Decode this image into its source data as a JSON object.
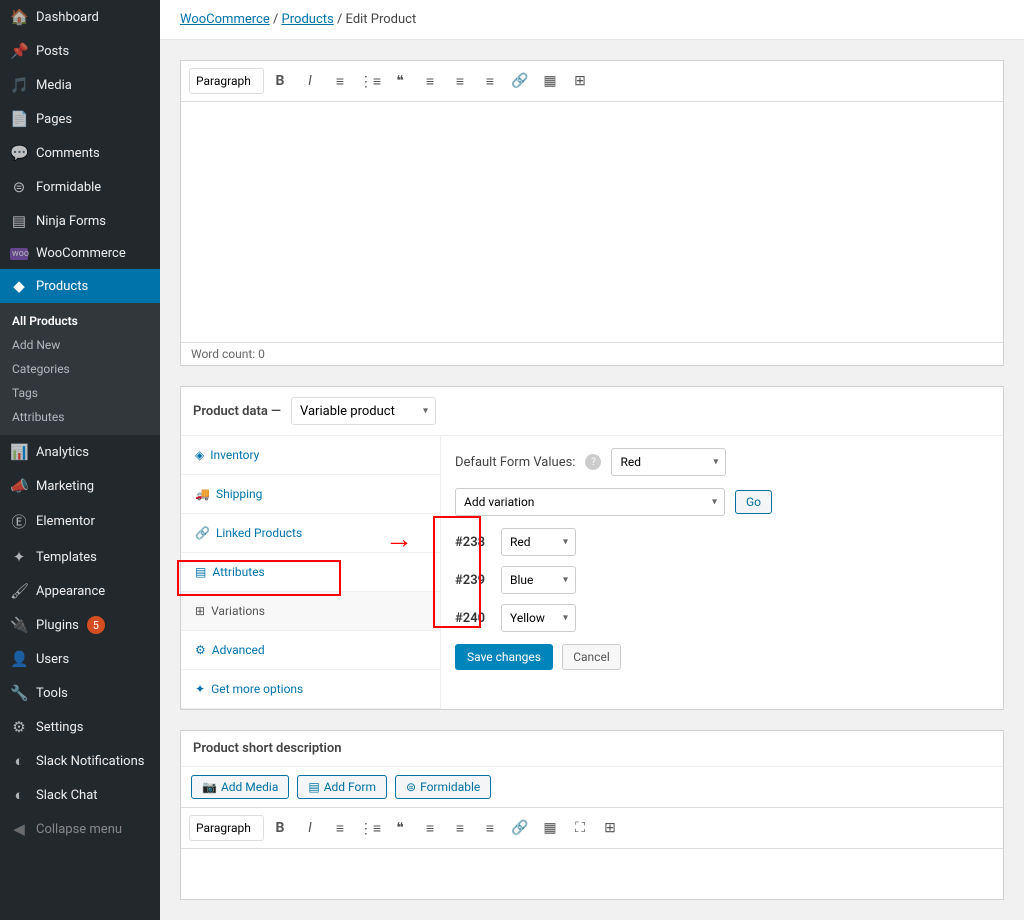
{
  "sidebar": {
    "items": [
      {
        "label": "Dashboard",
        "icon": "⚙"
      },
      {
        "label": "Posts",
        "icon": "📌"
      },
      {
        "label": "Media",
        "icon": "🖼"
      },
      {
        "label": "Pages",
        "icon": "📄"
      },
      {
        "label": "Comments",
        "icon": "💬"
      },
      {
        "label": "Formidable",
        "icon": "⊜"
      },
      {
        "label": "Ninja Forms",
        "icon": "▤"
      },
      {
        "label": "WooCommerce",
        "icon": "woo"
      },
      {
        "label": "Products",
        "icon": "◆"
      },
      {
        "label": "Analytics",
        "icon": "📊"
      },
      {
        "label": "Marketing",
        "icon": "📣"
      },
      {
        "label": "Elementor",
        "icon": "Ⓔ"
      },
      {
        "label": "Templates",
        "icon": "✦"
      },
      {
        "label": "Appearance",
        "icon": "🖌"
      },
      {
        "label": "Plugins",
        "icon": "🔌",
        "badge": "5"
      },
      {
        "label": "Users",
        "icon": "👤"
      },
      {
        "label": "Tools",
        "icon": "🔧"
      },
      {
        "label": "Settings",
        "icon": "⚙"
      },
      {
        "label": "Slack Notifications",
        "icon": "◐"
      },
      {
        "label": "Slack Chat",
        "icon": "◐"
      },
      {
        "label": "Collapse menu",
        "icon": "◀"
      }
    ],
    "sub": [
      {
        "label": "All Products",
        "current": true
      },
      {
        "label": "Add New"
      },
      {
        "label": "Categories"
      },
      {
        "label": "Tags"
      },
      {
        "label": "Attributes"
      }
    ]
  },
  "breadcrumb": {
    "woocommerce": "WooCommerce",
    "products": "Products",
    "current": "Edit Product"
  },
  "editor": {
    "format_select": "Paragraph",
    "word_count": "Word count: 0"
  },
  "productData": {
    "label": "Product data —",
    "type_select": "Variable product",
    "tabs": {
      "inventory": "Inventory",
      "shipping": "Shipping",
      "linked": "Linked Products",
      "attributes": "Attributes",
      "variations": "Variations",
      "advanced": "Advanced",
      "more": "Get more options"
    },
    "default_form_label": "Default Form Values:",
    "default_form_value": "Red",
    "add_variation": "Add variation",
    "go": "Go",
    "variations": [
      {
        "id": "#238",
        "value": "Red"
      },
      {
        "id": "#239",
        "value": "Blue"
      },
      {
        "id": "#240",
        "value": "Yellow"
      }
    ],
    "save": "Save changes",
    "cancel": "Cancel"
  },
  "shortDesc": {
    "title": "Product short description",
    "add_media": "Add Media",
    "add_form": "Add Form",
    "formidable": "Formidable",
    "format_select": "Paragraph"
  }
}
